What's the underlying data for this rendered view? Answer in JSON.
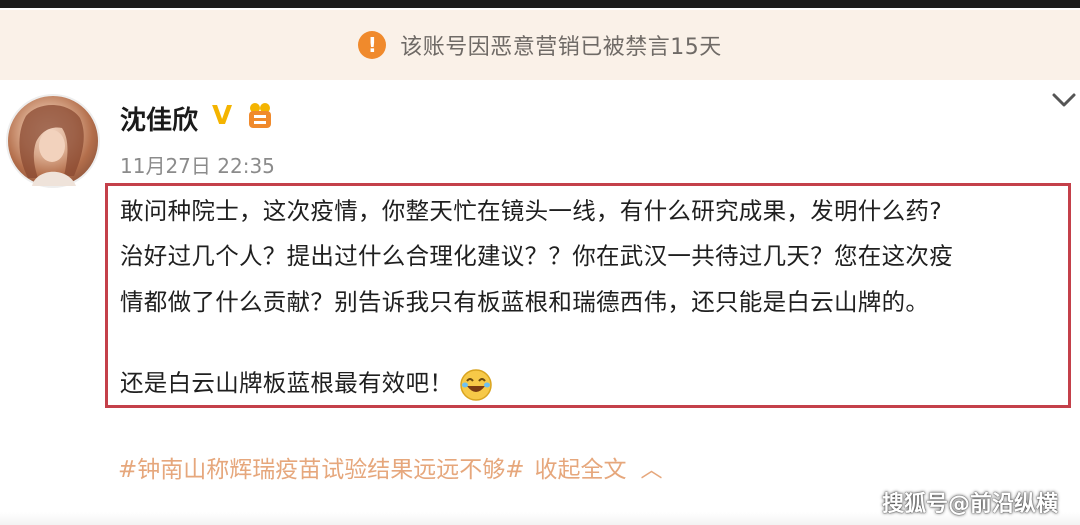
{
  "banner": {
    "icon": "warning-icon",
    "text": "该账号因恶意营销已被禁言15天"
  },
  "post": {
    "user_name": "沈佳欣",
    "verified_icon": "vip-v-icon",
    "badge_icon": "fan-badge-icon",
    "timestamp": "11月27日 22:35",
    "lines": [
      "敢问种院士，这次疫情，你整天忙在镜头一线，有什么研究成果，发明什么药?",
      "治好过几个人？提出过什么合理化建议？？你在武汉一共待过几天？您在这次疫",
      "情都做了什么贡献？别告诉我只有板蓝根和瑞德西伟，还只能是白云山牌的。",
      "还是白云山牌板蓝根最有效吧！"
    ],
    "emoji": "laugh-cry-emoji",
    "hashtag": "#钟南山称辉瑞疫苗试验结果远远不够#",
    "collapse_label": "收起全文",
    "colors": {
      "highlight_border": "#c4404a",
      "hashtag": "#e6a77c",
      "banner_bg": "#faf1e8",
      "warning": "#f08a2c"
    }
  },
  "watermark": "搜狐号@前沿纵横"
}
